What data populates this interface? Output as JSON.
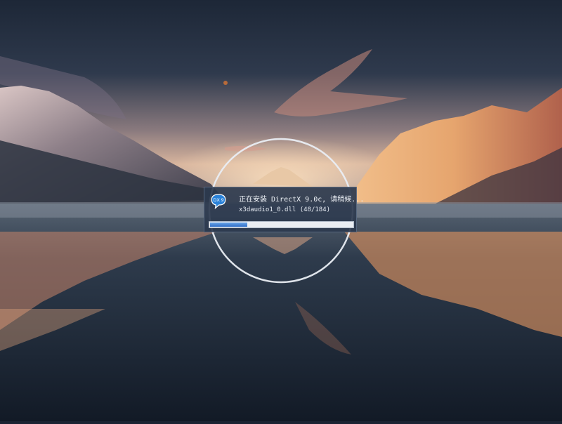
{
  "installer": {
    "logo_text": "DX 9",
    "status_text": "正在安装 DirectX 9.0c, 请稍候...",
    "current_file": "x3daudio1_0.dll (48/184)",
    "progress": {
      "current": 48,
      "total": 184
    }
  },
  "colors": {
    "panel": "#2c3a4e",
    "progress_fill": "#2f6fc9",
    "logo_blue": "#2a82d9"
  }
}
